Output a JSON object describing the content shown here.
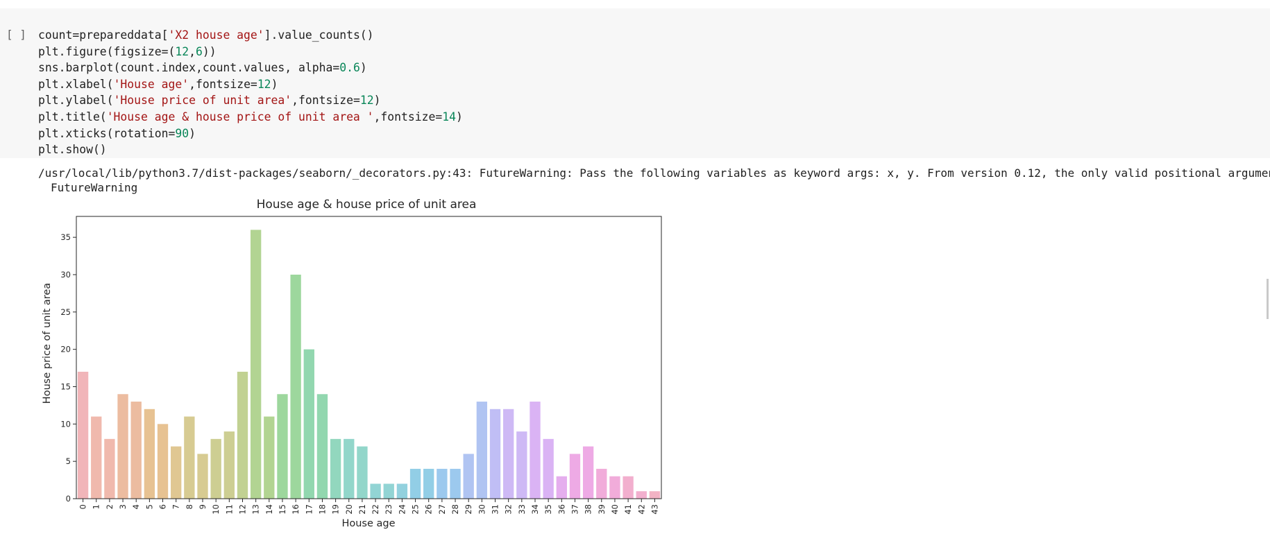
{
  "cell": {
    "bracket": "[ ]",
    "code_lines": [
      [
        {
          "t": "count=prepareddata["
        },
        {
          "t": "'X2 house age'",
          "c": "str"
        },
        {
          "t": "].value_counts()"
        }
      ],
      [
        {
          "t": "plt.figure(figsize=("
        },
        {
          "t": "12",
          "c": "num"
        },
        {
          "t": ","
        },
        {
          "t": "6",
          "c": "num"
        },
        {
          "t": "))"
        }
      ],
      [
        {
          "t": "sns.barplot(count.index,count.values, alpha="
        },
        {
          "t": "0.6",
          "c": "num"
        },
        {
          "t": ")"
        }
      ],
      [
        {
          "t": "plt.xlabel("
        },
        {
          "t": "'House age'",
          "c": "str"
        },
        {
          "t": ",fontsize="
        },
        {
          "t": "12",
          "c": "num"
        },
        {
          "t": ")"
        }
      ],
      [
        {
          "t": "plt.ylabel("
        },
        {
          "t": "'House price of unit area'",
          "c": "str"
        },
        {
          "t": ",fontsize="
        },
        {
          "t": "12",
          "c": "num"
        },
        {
          "t": ")"
        }
      ],
      [
        {
          "t": "plt.title("
        },
        {
          "t": "'House age & house price of unit area '",
          "c": "str"
        },
        {
          "t": ",fontsize="
        },
        {
          "t": "14",
          "c": "num"
        },
        {
          "t": ")"
        }
      ],
      [
        {
          "t": "plt.xticks(rotation="
        },
        {
          "t": "90",
          "c": "num"
        },
        {
          "t": ")"
        }
      ],
      [
        {
          "t": "plt.show()"
        }
      ]
    ]
  },
  "output": {
    "warning_line": "/usr/local/lib/python3.7/dist-packages/seaborn/_decorators.py:43: FutureWarning: Pass the following variables as keyword args: x, y. From version 0.12, the only valid positional argument",
    "warning_type": "FutureWarning"
  },
  "chart_data": {
    "type": "bar",
    "title": "House age & house price of unit area",
    "xlabel": "House age",
    "ylabel": "House price of unit area",
    "categories": [
      "0",
      "1",
      "2",
      "3",
      "4",
      "5",
      "6",
      "7",
      "8",
      "9",
      "10",
      "11",
      "12",
      "13",
      "14",
      "15",
      "16",
      "17",
      "18",
      "19",
      "20",
      "21",
      "22",
      "23",
      "24",
      "25",
      "26",
      "27",
      "28",
      "29",
      "30",
      "31",
      "32",
      "33",
      "34",
      "35",
      "36",
      "37",
      "38",
      "39",
      "40",
      "41",
      "42",
      "43"
    ],
    "values": [
      17,
      11,
      8,
      14,
      13,
      12,
      10,
      7,
      11,
      6,
      8,
      9,
      17,
      36,
      11,
      14,
      30,
      20,
      14,
      8,
      8,
      7,
      2,
      2,
      2,
      4,
      4,
      4,
      4,
      6,
      13,
      12,
      12,
      9,
      13,
      8,
      3,
      6,
      7,
      4,
      3,
      3,
      1,
      1
    ],
    "ylim": [
      0,
      37.8
    ],
    "yticks": [
      0,
      5,
      10,
      15,
      20,
      25,
      30,
      35
    ],
    "alpha": 0.6,
    "grid": false,
    "palette": [
      "#e8838b",
      "#e68a76",
      "#e09060",
      "#d7994a",
      "#cba24a",
      "#bca84a",
      "#abae4a",
      "#97b34a",
      "#7fb84a",
      "#5cbd5c",
      "#4abd7a",
      "#4abd92",
      "#4abba6",
      "#4ab8b8",
      "#4ab3c8",
      "#4aadd6",
      "#5aa5e2",
      "#7c9cea",
      "#9693ee",
      "#ad8aef",
      "#c281ec",
      "#d478e3",
      "#e271d4",
      "#e874c2",
      "#ea7aae",
      "#ea819c"
    ]
  }
}
